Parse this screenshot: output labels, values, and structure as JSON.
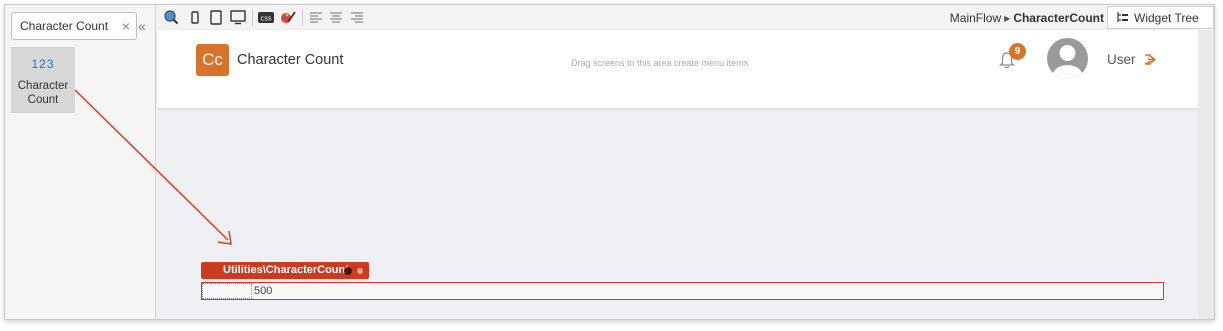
{
  "left_panel": {
    "search_value": "Character Count",
    "close_glyph": "×",
    "collapse_glyph": "«",
    "tile": {
      "number": "123",
      "label": "Character Count"
    }
  },
  "toolbar": {
    "icons": [
      "preview-icon",
      "phone-icon",
      "tablet-icon",
      "desktop-icon",
      "css-icon",
      "theme-icon",
      "align-left-icon",
      "align-center-icon",
      "align-right-icon"
    ],
    "breadcrumb": {
      "flow": "MainFlow",
      "screen": "CharacterCount"
    },
    "widget_tree_label": "Widget Tree"
  },
  "app": {
    "logo_text": "Cc",
    "title": "Character Count",
    "drag_hint": "Drag screens to this area create menu items",
    "notification_count": "9",
    "user_label": "User",
    "accent_color": "#d9722b"
  },
  "widget": {
    "tag_label": "Utilities\\CharacterCount",
    "value": "500",
    "tag_color": "#cc3a21"
  }
}
